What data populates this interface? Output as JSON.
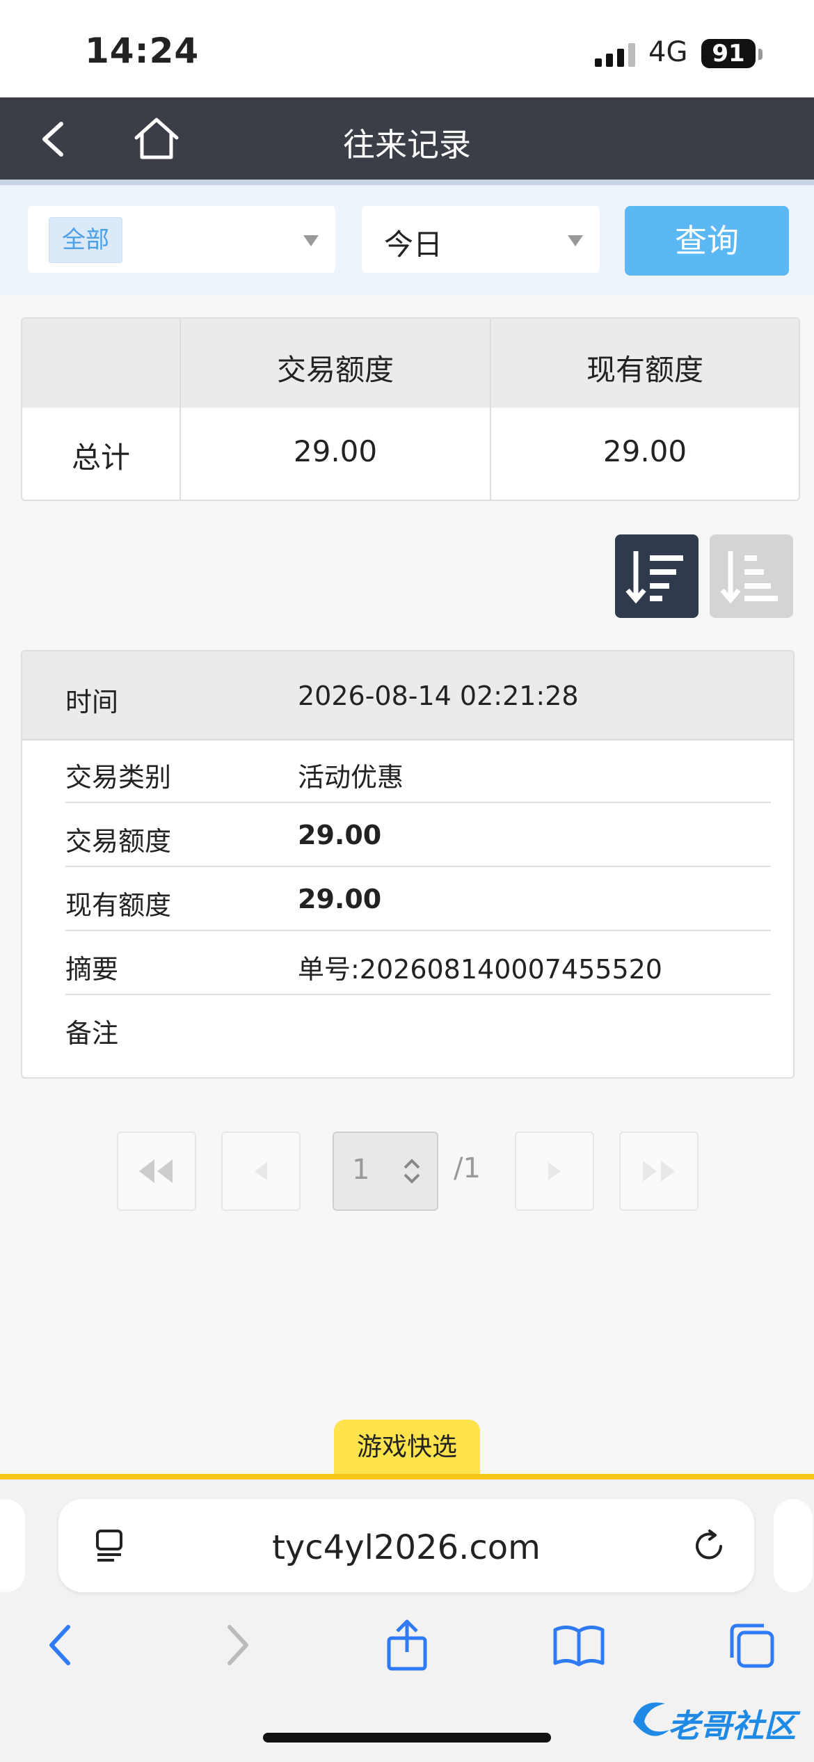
{
  "status_bar": {
    "time": "14:24",
    "network": "4G",
    "battery": "91"
  },
  "nav": {
    "title": "往来记录"
  },
  "filter": {
    "type_tag": "全部",
    "date_value": "今日",
    "query_button": "查询"
  },
  "summary": {
    "headers": [
      "",
      "交易额度",
      "现有额度"
    ],
    "row_label": "总计",
    "trade_amount": "29.00",
    "current_amount": "29.00"
  },
  "record": {
    "time_label": "时间",
    "time_value": "2026-08-14 02:21:28",
    "rows": [
      {
        "label": "交易类别",
        "value": "活动优惠"
      },
      {
        "label": "交易额度",
        "value": "29.00"
      },
      {
        "label": "现有额度",
        "value": "29.00"
      },
      {
        "label": "摘要",
        "value": "单号:202608140007455520"
      },
      {
        "label": "备注",
        "value": ""
      }
    ]
  },
  "pagination": {
    "current": "1",
    "total": "/1"
  },
  "game_tab": {
    "label": "游戏快选"
  },
  "browser": {
    "url": "tyc4yl2026.com"
  },
  "watermark": {
    "text": "老哥社区"
  },
  "colors": {
    "nav_bg": "#3b3e47",
    "accent_blue": "#5cb8f4",
    "yellow": "#f5c518"
  }
}
